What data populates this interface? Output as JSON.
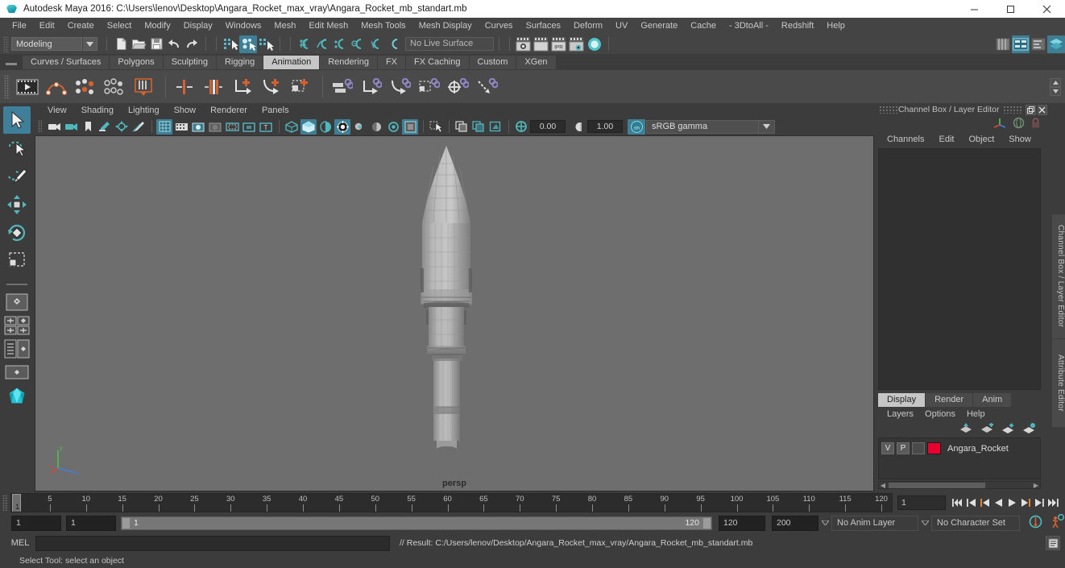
{
  "window": {
    "title": "Autodesk Maya 2016: C:\\Users\\lenov\\Desktop\\Angara_Rocket_max_vray\\Angara_Rocket_mb_standart.mb",
    "app_icon": "maya-icon",
    "minimize": "minimize-icon",
    "maximize": "maximize-icon",
    "close": "close-icon"
  },
  "menubar": {
    "items": [
      "File",
      "Edit",
      "Create",
      "Select",
      "Modify",
      "Display",
      "Windows",
      "Mesh",
      "Edit Mesh",
      "Mesh Tools",
      "Mesh Display",
      "Curves",
      "Surfaces",
      "Deform",
      "UV",
      "Generate",
      "Cache",
      "- 3DtoAll -",
      "Redshift",
      "Help"
    ]
  },
  "statusline": {
    "mode": "Modeling",
    "live_surface": "No Live Surface",
    "file_buttons": [
      "new-scene-icon",
      "open-scene-icon",
      "save-scene-icon",
      "undo-icon",
      "redo-icon"
    ],
    "select_mask_buttons": [
      "select-by-hierarchy-icon",
      "select-by-object-type-icon",
      "select-by-component-type-icon"
    ],
    "snap_buttons": [
      "snap-to-grid-icon",
      "snap-to-curve-icon",
      "snap-to-point-icon",
      "snap-to-projected-center-icon",
      "snap-to-view-plane-icon",
      "make-live-icon"
    ],
    "render_buttons": [
      "render-current-frame-icon",
      "redo-render-icon",
      "ipr-render-icon",
      "render-settings-icon",
      "hypershade-icon"
    ],
    "right_buttons": [
      "show-hide-attribute-editor-icon",
      "show-hide-tool-settings-icon",
      "show-hide-channel-box-icon",
      "layer-editor-icon"
    ],
    "ipr_label": "IPR"
  },
  "shelf": {
    "tabs": [
      "Curves / Surfaces",
      "Polygons",
      "Sculpting",
      "Rigging",
      "Animation",
      "Rendering",
      "FX",
      "FX Caching",
      "Custom",
      "XGen"
    ],
    "active_tab": "Animation",
    "icons": [
      "playblast-icon",
      "set-key-icon",
      "key-channels-icon",
      "breakdown-key-icon",
      "ghost-icon",
      "set-ik-fk-key-icon",
      "set-full-body-key-icon",
      "parent-constraint-icon",
      "point-constraint-icon",
      "orient-constraint-icon",
      "connect-joints-icon",
      "parent-icon",
      "aim-constraint-icon",
      "scale-constraint-icon",
      "geometry-constraint-icon",
      "normal-constraint-icon"
    ]
  },
  "toolbox": {
    "tools": [
      {
        "name": "select-tool",
        "active": true
      },
      {
        "name": "lasso-select-tool",
        "active": false
      },
      {
        "name": "paint-select-tool",
        "active": false
      },
      {
        "name": "move-tool",
        "active": false
      },
      {
        "name": "rotate-tool",
        "active": false
      },
      {
        "name": "scale-tool",
        "active": false
      }
    ],
    "layout_buttons": [
      "single-perspective-view-icon",
      "four-view-layout-icon",
      "persp-outliner-layout-icon",
      "persp-graph-editor-icon",
      "maya-logo-icon"
    ]
  },
  "viewport": {
    "menus": [
      "View",
      "Shading",
      "Lighting",
      "Show",
      "Renderer",
      "Panels"
    ],
    "camera_label": "persp",
    "toolbar": {
      "exposure": "0.00",
      "gamma": "1.00",
      "color_management": "sRGB gamma",
      "buttons": [
        "select-camera-icon",
        "camera-attributes-icon",
        "bookmark-icon",
        "image-plane-icon",
        "2d-pan-zoom-icon",
        "grease-pencil-icon",
        "grid-icon",
        "film-gate-icon",
        "resolution-gate-icon",
        "gate-mask-icon",
        "film-origin-icon",
        "safe-action-icon",
        "safe-title-icon",
        "wireframe-icon",
        "smooth-shade-all-icon",
        "smooth-shade-selected-icon",
        "use-all-lights-icon",
        "shadows-icon",
        "screen-space-ao-icon",
        "motion-blur-icon",
        "multisample-aa-icon",
        "depth-of-field-icon",
        "isolate-select-icon",
        "xray-icon",
        "xray-joints-icon",
        "xray-active-components-icon",
        "exposure-icon",
        "gamma-icon",
        "color-management-toggle-icon"
      ]
    },
    "axis_gizmo": {
      "x": "x",
      "y": "y",
      "z": "z"
    }
  },
  "channel_box_panel": {
    "title": "Channel Box / Layer Editor",
    "menus": [
      "Channels",
      "Edit",
      "Object",
      "Show"
    ],
    "undock_icon": "undock-icon",
    "close_icon": "close-panel-icon",
    "top_icons": [
      "manipulator-icon",
      "sphere-icon",
      "lock-icon"
    ],
    "side_tabs": [
      "Channel Box / Layer Editor",
      "Attribute Editor"
    ]
  },
  "layer_editor": {
    "tabs": [
      "Display",
      "Render",
      "Anim"
    ],
    "active_tab": "Display",
    "menus": [
      "Layers",
      "Options",
      "Help"
    ],
    "buttons": [
      "new-layer-icon",
      "new-layer-from-selected-icon",
      "add-selected-to-layer-icon",
      "select-objects-in-layer-icon"
    ],
    "layers": [
      {
        "visibility": "V",
        "playback": "P",
        "state": "",
        "color": "#e8002e",
        "name": "Angara_Rocket"
      }
    ]
  },
  "timeline": {
    "start": 1,
    "end": 120,
    "tick_labels": [
      5,
      10,
      15,
      20,
      25,
      30,
      35,
      40,
      45,
      50,
      55,
      60,
      65,
      70,
      75,
      80,
      85,
      90,
      95,
      100,
      105,
      110,
      115,
      120
    ],
    "current_frame": "1",
    "current_frame_field": "1",
    "playback_buttons": [
      "go-to-start-icon",
      "step-back-keyframe-icon",
      "step-back-frame-icon",
      "play-backwards-icon",
      "play-forwards-icon",
      "step-forward-frame-icon",
      "step-forward-keyframe-icon",
      "go-to-end-icon"
    ]
  },
  "range_slider": {
    "anim_start": "1",
    "playback_start": "1",
    "range_low_label": "1",
    "range_high_label": "120",
    "playback_end": "120",
    "anim_end": "200",
    "anim_layer": "No Anim Layer",
    "character_set": "No Character Set",
    "auto_key_icon": "auto-keyframe-icon",
    "anim_prefs_icon": "animation-preferences-icon"
  },
  "command_line": {
    "label": "MEL",
    "input_value": "",
    "result": "// Result: C:/Users/lenov/Desktop/Angara_Rocket_max_vray/Angara_Rocket_mb_standart.mb",
    "script_editor_icon": "script-editor-icon"
  },
  "status_help": {
    "text": "Select Tool: select an object"
  },
  "colors": {
    "accent_blue": "#3e7f96",
    "shelf_orange": "#d2622e",
    "layer_red": "#e8002e",
    "panel_bg": "#3c3c3c",
    "viewport_bg": "#6e6e6e"
  }
}
